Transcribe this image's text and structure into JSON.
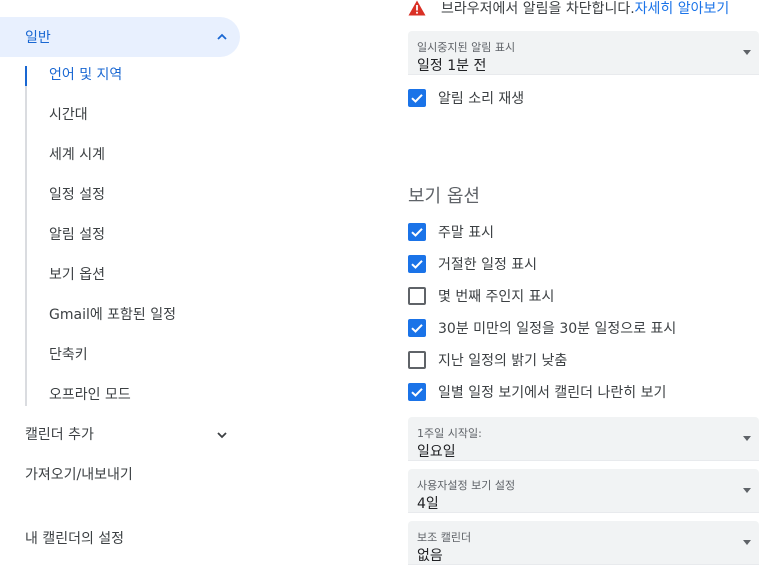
{
  "sidebar": {
    "general_label": "일반",
    "sub_items": [
      {
        "label": "언어 및 지역",
        "active": true
      },
      {
        "label": "시간대",
        "active": false
      },
      {
        "label": "세계 시계",
        "active": false
      },
      {
        "label": "일정 설정",
        "active": false
      },
      {
        "label": "알림 설정",
        "active": false
      },
      {
        "label": "보기 옵션",
        "active": false
      },
      {
        "label": "Gmail에 포함된 일정",
        "active": false
      },
      {
        "label": "단축키",
        "active": false
      },
      {
        "label": "오프라인 모드",
        "active": false
      }
    ],
    "add_calendar_label": "캘린더 추가",
    "import_export_label": "가져오기/내보내기",
    "my_calendars_label": "내 캘린더의 설정"
  },
  "main": {
    "warning": {
      "text": "브라우저에서 알림을 차단합니다.",
      "link": "자세히 알아보기"
    },
    "paused_notifications": {
      "caption": "일시중지된 알림 표시",
      "value": "일정 1분 전"
    },
    "play_sound": {
      "label": "알림 소리 재생",
      "checked": true
    },
    "view_options_title": "보기 옵션",
    "view_checkboxes": [
      {
        "label": "주말 표시",
        "checked": true
      },
      {
        "label": "거절한 일정 표시",
        "checked": true
      },
      {
        "label": "몇 번째 주인지 표시",
        "checked": false
      },
      {
        "label": "30분 미만의 일정을 30분 일정으로 표시",
        "checked": true
      },
      {
        "label": "지난 일정의 밝기 낮춤",
        "checked": false
      },
      {
        "label": "일별 일정 보기에서 캘린더 나란히 보기",
        "checked": true
      }
    ],
    "week_start": {
      "caption": "1주일 시작일:",
      "value": "일요일"
    },
    "custom_view": {
      "caption": "사용자설정 보기 설정",
      "value": "4일"
    },
    "secondary_calendar": {
      "caption": "보조 캘린더",
      "value": "없음"
    }
  },
  "colors": {
    "accent": "#1a73e8",
    "active_nav_bg": "#e8f0fe",
    "warning_red": "#d93025"
  },
  "icons": [
    "chevron-up-icon",
    "chevron-down-icon",
    "warning-icon",
    "check-icon",
    "dropdown-arrow-icon"
  ]
}
